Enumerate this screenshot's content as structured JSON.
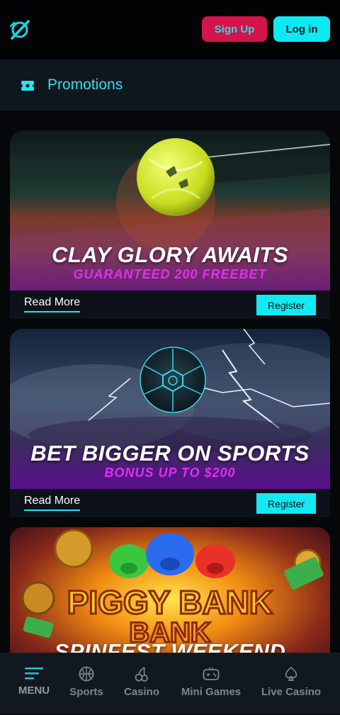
{
  "header": {
    "logo": "brand-logo",
    "signup_label": "Sign Up",
    "login_label": "Log in"
  },
  "promotions": {
    "icon": "ticket-icon",
    "title": "Promotions"
  },
  "cards": [
    {
      "title": "CLAY GLORY AWAITS",
      "subtitle": "GUARANTEED 200 FREEBET",
      "read_more": "Read More",
      "register": "Register"
    },
    {
      "title": "BET BIGGER ON SPORTS",
      "subtitle": "BONUS UP TO $200",
      "read_more": "Read More",
      "register": "Register"
    },
    {
      "title": "SPINFEST WEEKEND",
      "logo_text": "PIGGY BANK"
    }
  ],
  "bottom_nav": [
    {
      "label": "MENU",
      "icon": "menu-icon"
    },
    {
      "label": "Sports",
      "icon": "basketball-icon"
    },
    {
      "label": "Casino",
      "icon": "cherry-icon"
    },
    {
      "label": "Mini Games",
      "icon": "gamepad-icon"
    },
    {
      "label": "Live Casino",
      "icon": "spade-icon"
    }
  ],
  "colors": {
    "accent": "#10e8f2",
    "signup": "#d4144a",
    "subtitle": "#e02ff0",
    "background": "#050708"
  }
}
